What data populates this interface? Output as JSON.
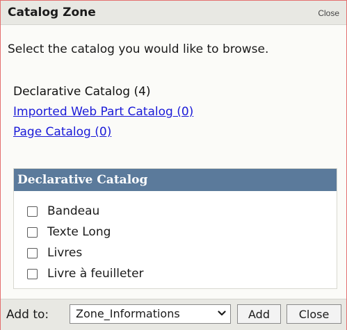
{
  "zone": {
    "title": "Catalog Zone",
    "close_link": "Close",
    "instructions": "Select the catalog you would like to browse."
  },
  "catalogs": [
    {
      "label": "Declarative Catalog (4)",
      "current": true
    },
    {
      "label": "Imported Web Part Catalog (0)",
      "current": false
    },
    {
      "label": "Page Catalog (0)",
      "current": false
    }
  ],
  "selected_catalog": {
    "header": "Declarative Catalog",
    "parts": [
      {
        "label": "Bandeau",
        "checked": false
      },
      {
        "label": "Texte Long",
        "checked": false
      },
      {
        "label": "Livres",
        "checked": false
      },
      {
        "label": "Livre à feuilleter",
        "checked": false
      }
    ]
  },
  "footer": {
    "add_to_label": "Add to:",
    "zone_select_value": "Zone_Informations",
    "add_button": "Add",
    "close_button": "Close"
  },
  "colors": {
    "header_bg": "#5b7a9b",
    "link": "#1a1ad8",
    "border": "#e46f6f"
  }
}
